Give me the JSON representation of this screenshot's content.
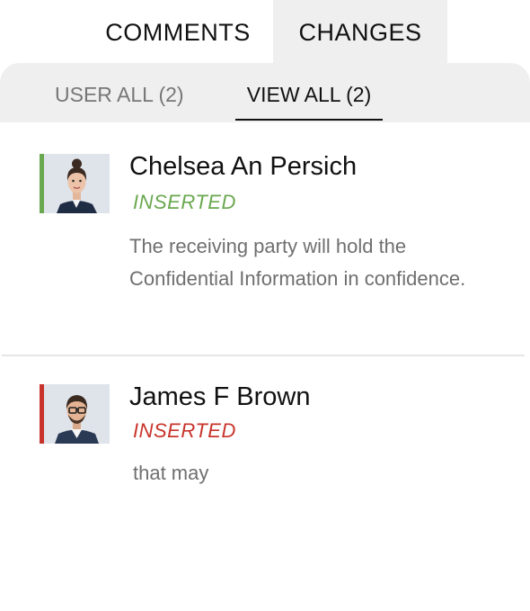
{
  "tabs": [
    {
      "label": "COMMENTS",
      "active": false
    },
    {
      "label": "CHANGES",
      "active": true
    }
  ],
  "subtabs": [
    {
      "label": "USER ALL (2)",
      "active": false
    },
    {
      "label": "VIEW ALL (2)",
      "active": true
    }
  ],
  "changes": [
    {
      "author": "Chelsea An Persich",
      "status": "INSERTED",
      "status_color": "#6aa84f",
      "accent_color": "#6aa84f",
      "avatar_icon": "female-avatar-photo",
      "text": "The receiving party will hold the Confidential Information in confidence."
    },
    {
      "author": "James F Brown",
      "status": "INSERTED",
      "status_color": "#c8342b",
      "accent_color": "#c8342b",
      "avatar_icon": "male-avatar-photo",
      "text": "that may"
    }
  ]
}
